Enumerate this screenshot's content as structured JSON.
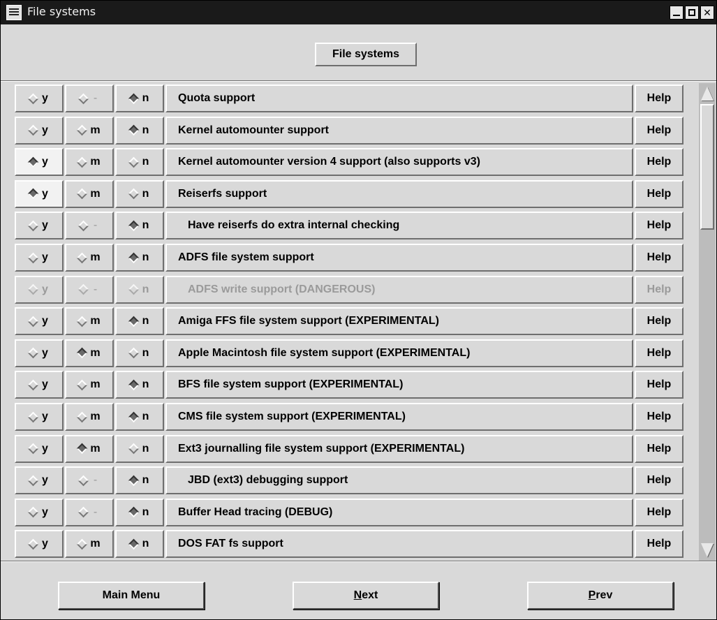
{
  "window": {
    "title": "File systems"
  },
  "header": {
    "button_label": "File systems"
  },
  "options": [
    {
      "label": "Quota support",
      "y": "y",
      "m": "-",
      "n": "n",
      "selected": "n",
      "indent": false,
      "disabled": false,
      "help": "Help"
    },
    {
      "label": "Kernel automounter support",
      "y": "y",
      "m": "m",
      "n": "n",
      "selected": "n",
      "indent": false,
      "disabled": false,
      "help": "Help"
    },
    {
      "label": "Kernel automounter version 4 support (also supports v3)",
      "y": "y",
      "m": "m",
      "n": "n",
      "selected": "y",
      "indent": false,
      "disabled": false,
      "help": "Help"
    },
    {
      "label": "Reiserfs support",
      "y": "y",
      "m": "m",
      "n": "n",
      "selected": "y",
      "indent": false,
      "disabled": false,
      "help": "Help"
    },
    {
      "label": "Have reiserfs do extra internal checking",
      "y": "y",
      "m": "-",
      "n": "n",
      "selected": "n",
      "indent": true,
      "disabled": false,
      "help": "Help"
    },
    {
      "label": "ADFS file system support",
      "y": "y",
      "m": "m",
      "n": "n",
      "selected": "n",
      "indent": false,
      "disabled": false,
      "help": "Help"
    },
    {
      "label": "ADFS write support (DANGEROUS)",
      "y": "y",
      "m": "-",
      "n": "n",
      "selected": "",
      "indent": true,
      "disabled": true,
      "help": "Help"
    },
    {
      "label": "Amiga FFS file system support (EXPERIMENTAL)",
      "y": "y",
      "m": "m",
      "n": "n",
      "selected": "n",
      "indent": false,
      "disabled": false,
      "help": "Help"
    },
    {
      "label": "Apple Macintosh file system support (EXPERIMENTAL)",
      "y": "y",
      "m": "m",
      "n": "n",
      "selected": "m",
      "indent": false,
      "disabled": false,
      "help": "Help"
    },
    {
      "label": "BFS file system support (EXPERIMENTAL)",
      "y": "y",
      "m": "m",
      "n": "n",
      "selected": "n",
      "indent": false,
      "disabled": false,
      "help": "Help"
    },
    {
      "label": "CMS file system support (EXPERIMENTAL)",
      "y": "y",
      "m": "m",
      "n": "n",
      "selected": "n",
      "indent": false,
      "disabled": false,
      "help": "Help"
    },
    {
      "label": "Ext3 journalling file system support (EXPERIMENTAL)",
      "y": "y",
      "m": "m",
      "n": "n",
      "selected": "m",
      "indent": false,
      "disabled": false,
      "help": "Help"
    },
    {
      "label": "JBD (ext3) debugging support",
      "y": "y",
      "m": "-",
      "n": "n",
      "selected": "n",
      "indent": true,
      "disabled": false,
      "help": "Help"
    },
    {
      "label": "Buffer Head tracing (DEBUG)",
      "y": "y",
      "m": "-",
      "n": "n",
      "selected": "n",
      "indent": false,
      "disabled": false,
      "help": "Help"
    },
    {
      "label": "DOS FAT fs support",
      "y": "y",
      "m": "m",
      "n": "n",
      "selected": "n",
      "indent": false,
      "disabled": false,
      "help": "Help"
    }
  ],
  "footer": {
    "main_menu": "Main Menu",
    "next_first": "N",
    "next_rest": "ext",
    "prev_first": "P",
    "prev_rest": "rev"
  },
  "scrollbar": {
    "position_fraction": 0.0
  }
}
